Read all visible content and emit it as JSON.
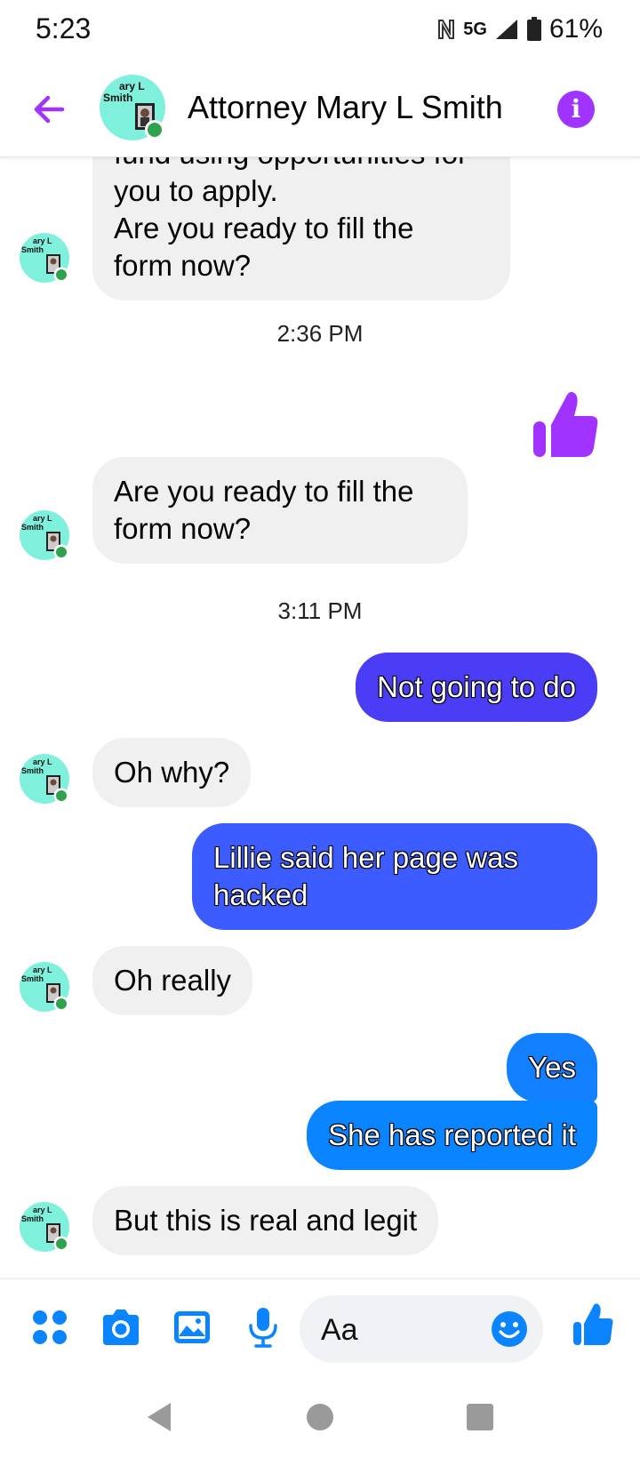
{
  "status_bar": {
    "time": "5:23",
    "nfc_icon": "nfc-icon",
    "network": "5G",
    "battery": "61%"
  },
  "header": {
    "back_icon": "back-arrow-icon",
    "avatar_label_line1": "ary L",
    "avatar_label_line2": "Smith",
    "title": "Attorney Mary L Smith",
    "info_icon": "i",
    "online": true
  },
  "messages": {
    "m1": {
      "sender": "contact",
      "text": "fund using opportunities for\nyou to apply.\nAre you ready to fill the\nform now?"
    },
    "t1": "2:36 PM",
    "m2": {
      "sender": "me",
      "type": "thumbs-up"
    },
    "m3": {
      "sender": "contact",
      "text": "Are you ready to fill the\nform now?"
    },
    "t2": "3:11 PM",
    "m4": {
      "sender": "me",
      "text": "Not going to do"
    },
    "m5": {
      "sender": "contact",
      "text": "Oh why?"
    },
    "m6": {
      "sender": "me",
      "text": "Lillie said her page was\nhacked"
    },
    "m7": {
      "sender": "contact",
      "text": "Oh really"
    },
    "m8": {
      "sender": "me",
      "text": "Yes"
    },
    "m9": {
      "sender": "me",
      "text": "She has reported it"
    },
    "m10": {
      "sender": "contact",
      "text": "But this is real and legit"
    }
  },
  "composer": {
    "icons": [
      "apps-icon",
      "camera-icon",
      "gallery-icon",
      "microphone-icon"
    ],
    "placeholder": "Aa",
    "emoji_icon": "emoji-icon",
    "like_icon": "thumbs-up-icon"
  },
  "colors": {
    "accent_purple": "#a033ff",
    "bubble_violet": "#4b3cf5",
    "bubble_blue": "#3d5cff",
    "bubble_azure": "#1380ff",
    "incoming_bubble": "#f0f0f0",
    "messenger_blue": "#0a84ff",
    "online_green": "#31a24c"
  }
}
